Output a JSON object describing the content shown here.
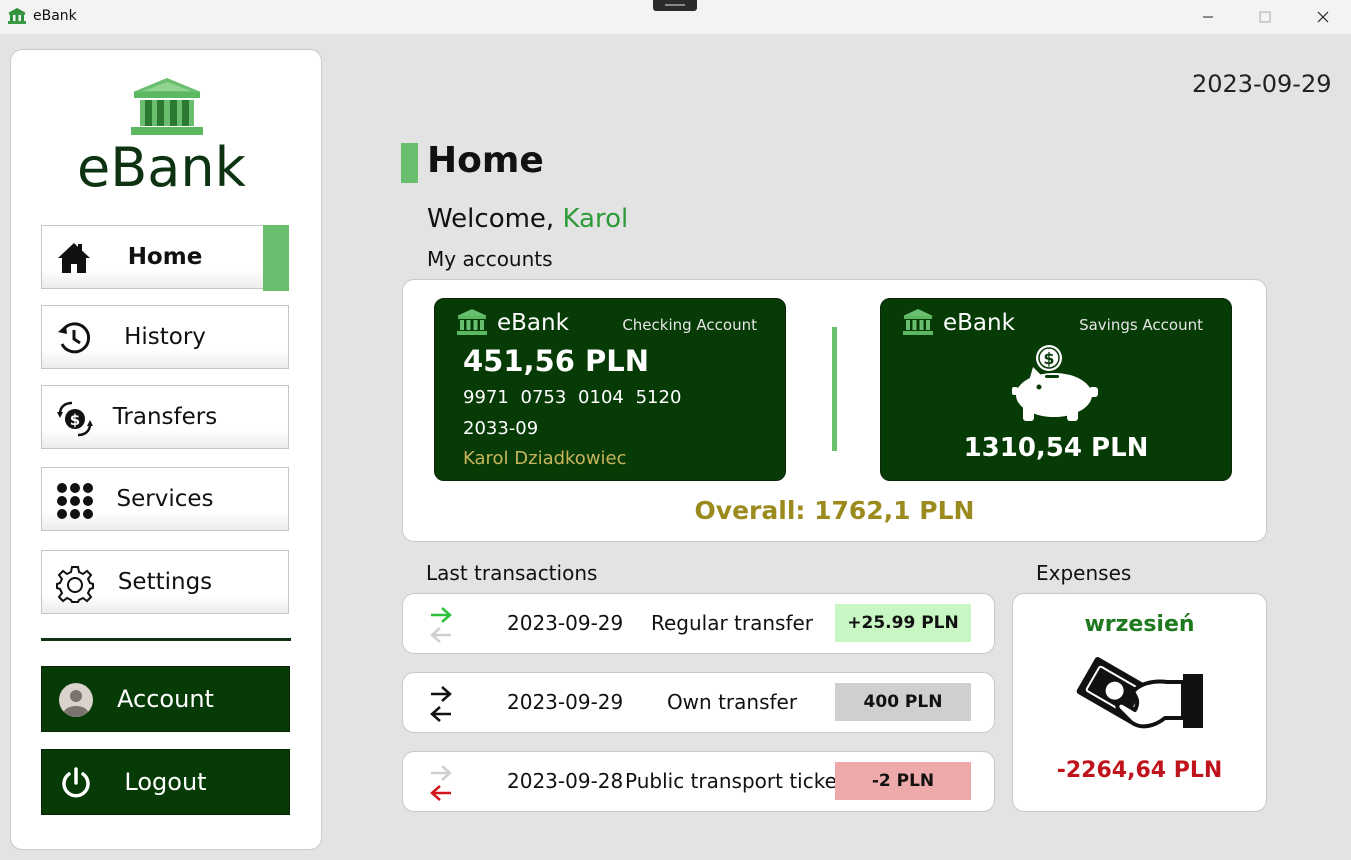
{
  "window": {
    "title": "eBank",
    "icon": "bank-icon"
  },
  "sidebar": {
    "logo_text": "eBank",
    "logo_icon": "bank-icon",
    "nav": [
      {
        "label": "Home",
        "icon": "home-icon",
        "active": true
      },
      {
        "label": "History",
        "icon": "history-icon"
      },
      {
        "label": "Transfers",
        "icon": "transfer-icon"
      },
      {
        "label": "Services",
        "icon": "grid-icon"
      },
      {
        "label": "Settings",
        "icon": "gear-icon"
      }
    ],
    "account_label": "Account",
    "logout_label": "Logout"
  },
  "header": {
    "date": "2023-09-29"
  },
  "main": {
    "title": "Home",
    "welcome_prefix": "Welcome,",
    "user_name": "Karol",
    "my_accounts_label": "My accounts",
    "checking": {
      "brand": "eBank",
      "type": "Checking Account",
      "balance": "451,56 PLN",
      "number": "9971 0753 0104 5120",
      "expiry": "2033-09",
      "holder": "Karol Dziadkowiec"
    },
    "savings": {
      "brand": "eBank",
      "type": "Savings Account",
      "balance": "1310,54 PLN"
    },
    "overall": "Overall: 1762,1 PLN",
    "last_transactions_label": "Last transactions",
    "transactions": [
      {
        "date": "2023-09-29",
        "description": "Regular transfer",
        "amount": "+25.99 PLN",
        "direction": "incoming",
        "amount_bg": "#c9f7c4"
      },
      {
        "date": "2023-09-29",
        "description": "Own transfer",
        "amount": "400 PLN",
        "direction": "own",
        "amount_bg": "#cfcfcf"
      },
      {
        "date": "2023-09-28",
        "description": "Public transport ticket",
        "amount": "-2 PLN",
        "direction": "outgoing",
        "amount_bg": "#eeaaaa"
      }
    ],
    "expenses_label": "Expenses",
    "expenses": {
      "month": "wrzesień",
      "amount": "-2264,64 PLN",
      "icon": "payment-hand-icon"
    }
  },
  "colors": {
    "accent_green": "#6abf6e",
    "card_dark_green": "#063b06",
    "gold": "#9b8a1d",
    "expense_red": "#c0141c"
  }
}
